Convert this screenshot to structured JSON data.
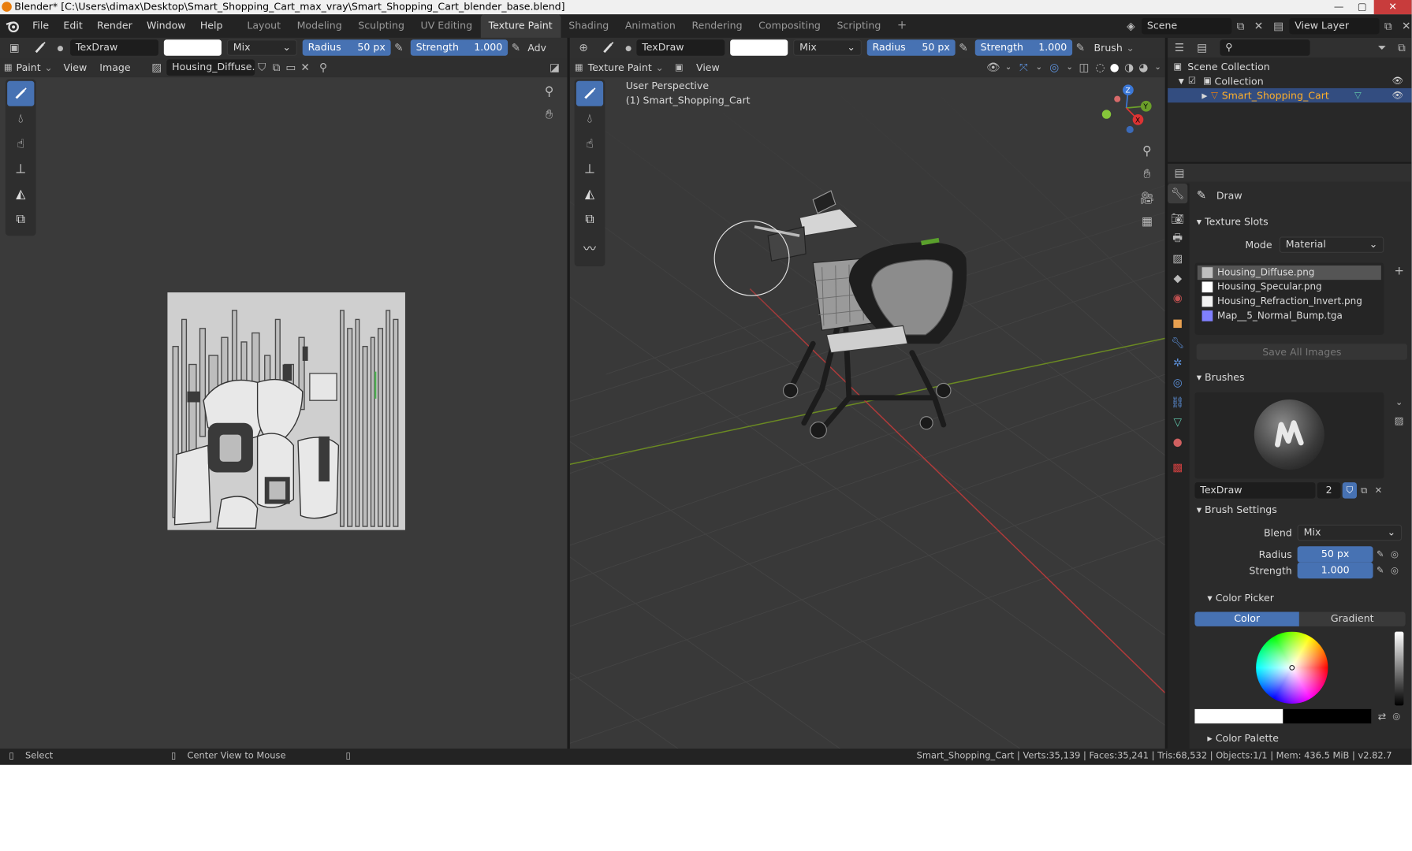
{
  "window": {
    "title": "Blender* [C:\\Users\\dimax\\Desktop\\Smart_Shopping_Cart_max_vray\\Smart_Shopping_Cart_blender_base.blend]",
    "controls": [
      "—",
      "▢",
      "✕"
    ]
  },
  "menu": [
    "File",
    "Edit",
    "Render",
    "Window",
    "Help"
  ],
  "workspaces": [
    "Layout",
    "Modeling",
    "Sculpting",
    "UV Editing",
    "Texture Paint",
    "Shading",
    "Animation",
    "Rendering",
    "Compositing",
    "Scripting",
    "+"
  ],
  "active_workspace": "Texture Paint",
  "scene": {
    "label": "Scene",
    "view_layer": "View Layer"
  },
  "image_editor": {
    "brush_name": "TexDraw",
    "blend": "Mix",
    "radius_label": "Radius",
    "radius_value": "50 px",
    "strength_label": "Strength",
    "strength_value": "1.000",
    "adv_label": "Adv",
    "mode": "Paint",
    "menus": [
      "View",
      "Image"
    ],
    "image_name": "Housing_Diffuse.png"
  },
  "viewport": {
    "brush_name": "TexDraw",
    "blend": "Mix",
    "radius_label": "Radius",
    "radius_value": "50 px",
    "strength_label": "Strength",
    "strength_value": "1.000",
    "brush_menu": "Brush",
    "mode": "Texture Paint",
    "view_menu": "View",
    "overlay_line1": "User Perspective",
    "overlay_line2": "(1) Smart_Shopping_Cart",
    "gizmo": {
      "z": "Z",
      "y": "Y",
      "x": "X"
    }
  },
  "outliner": {
    "scene_collection": "Scene Collection",
    "collection": "Collection",
    "object": "Smart_Shopping_Cart"
  },
  "properties": {
    "tool_name": "Draw",
    "texture_slots": {
      "title": "Texture Slots",
      "mode_label": "Mode",
      "mode_value": "Material",
      "slots": [
        {
          "name": "Housing_Diffuse.png",
          "swatch": "#bfbfbf",
          "selected": true
        },
        {
          "name": "Housing_Specular.png",
          "swatch": "#ffffff",
          "selected": false
        },
        {
          "name": "Housing_Refraction_Invert.png",
          "swatch": "#f2f2f2",
          "selected": false
        },
        {
          "name": "Map__5_Normal_Bump.tga",
          "swatch": "#8080ff",
          "selected": false
        }
      ],
      "save_all": "Save All Images"
    },
    "brushes": {
      "title": "Brushes",
      "brush_name": "TexDraw",
      "users": "2"
    },
    "brush_settings": {
      "title": "Brush Settings",
      "blend_label": "Blend",
      "blend_value": "Mix",
      "radius_label": "Radius",
      "radius_value": "50 px",
      "strength_label": "Strength",
      "strength_value": "1.000"
    },
    "color_picker": {
      "title": "Color Picker",
      "tab_color": "Color",
      "tab_gradient": "Gradient"
    },
    "color_palette": {
      "title": "Color Palette"
    }
  },
  "status": {
    "left_action": "Select",
    "middle_action": "Center View to Mouse",
    "stats": "Smart_Shopping_Cart | Verts:35,139 | Faces:35,241 | Tris:68,532 | Objects:1/1 | Mem: 436.5 MiB | v2.82.7"
  },
  "colors": {
    "accent": "#4772b3",
    "selected_object": "#e87d0d",
    "x_axis": "#b03a3a",
    "y_axis": "#6b8a22"
  }
}
